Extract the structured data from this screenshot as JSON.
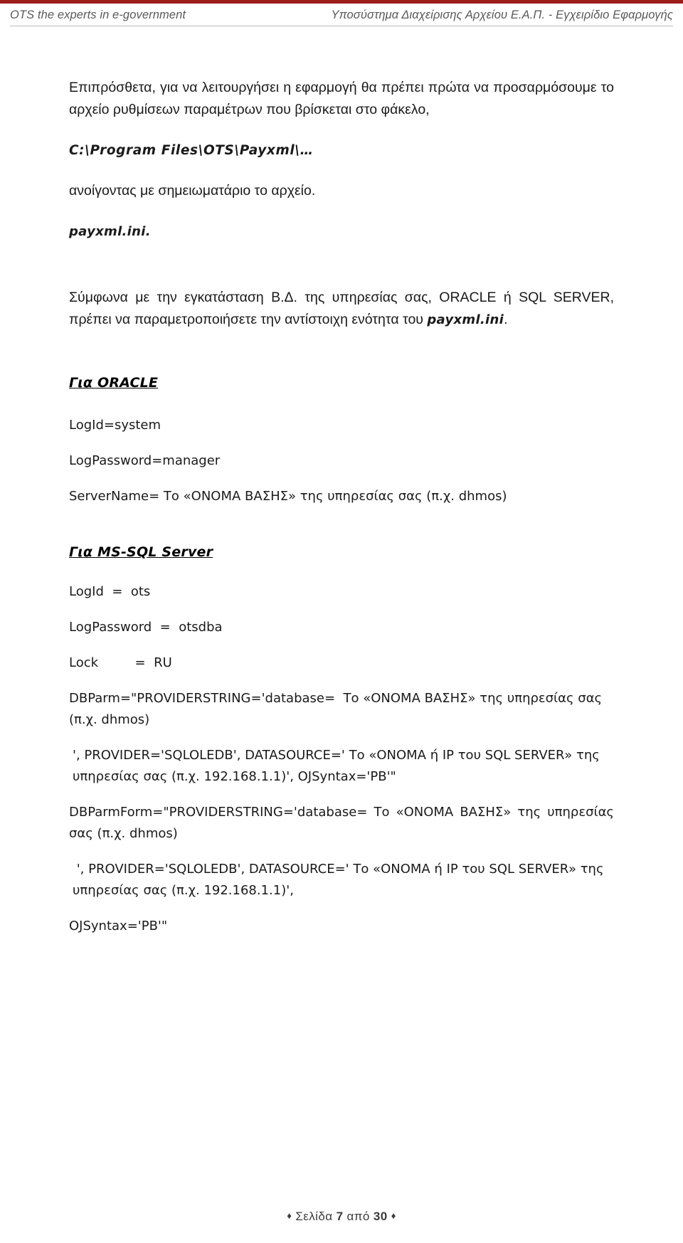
{
  "header": {
    "left_text": "OTS the experts in e-government",
    "right_text": "Υποσύστημα Διαχείρισης Αρχείου Ε.Α.Π. - Εγχειρίδιο Εφαρμογής",
    "rule_color": "#9e1b1b"
  },
  "body": {
    "intro_paragraph": "Επιπρόσθετα, για να λειτουργήσει η εφαρμογή θα πρέπει πρώτα να προσαρμόσουμε το αρχείο ρυθμίσεων παραμέτρων που βρίσκεται στο φάκελο,",
    "path_line": "C:\\Program Files\\OTS\\Payxml\\…",
    "open_with_notepad": "ανοίγοντας με σημειωματάριο το αρχείο.",
    "ini_file": "payxml.ini.",
    "install_paragraph_part1": "Σύμφωνα με την εγκατάσταση Β.Δ. της υπηρεσίας σας,  ORACLE ή SQL SERVER, πρέπει να παραμετροποιήσετε την αντίστοιχη ενότητα του ",
    "install_paragraph_bold": "payxml.ini",
    "install_paragraph_part2": "."
  },
  "oracle_section": {
    "title": "Για ORACLE",
    "lines": [
      "LogId=system",
      "LogPassword=manager",
      "ServerName= Το «ΟΝΟΜΑ ΒΑΣΗΣ» της υπηρεσίας σας (π.χ. dhmos)"
    ]
  },
  "mssql_section": {
    "title": "Για MS-SQL Server",
    "lines": [
      "LogId  =  ots",
      "LogPassword  =  otsdba",
      "Lock         =  RU"
    ],
    "dbparm": "DBParm=\"PROVIDERSTRING='database=  Το «ΟΝΟΜΑ ΒΑΣΗΣ» της υπηρεσίας σας (π.χ. dhmos)",
    "dbparm_cont": "', PROVIDER='SQLOLEDB', DATASOURCE=' Το «ΟΝΟΜΑ ή ΙΡ του SQL SERVER» της υπηρεσίας σας (π.χ. 192.168.1.1)', OJSyntax='PB'\"",
    "dbparmform": "DBParmForm=\"PROVIDERSTRING='database= Το «ΟΝΟΜΑ ΒΑΣΗΣ» της υπηρεσίας σας (π.χ. dhmos)",
    "dbparmform_cont": " ', PROVIDER='SQLOLEDB', DATASOURCE=' Το «ΟΝΟΜΑ ή ΙΡ του SQL SERVER» της υπηρεσίας σας (π.χ. 192.168.1.1)',",
    "ojsyntax": "OJSyntax='PB'\""
  },
  "footer": {
    "left_diamond": "♦",
    "prefix": "Σελίδα",
    "page_number": "7",
    "middle": "από",
    "total_pages": "30",
    "right_diamond": "♦"
  }
}
